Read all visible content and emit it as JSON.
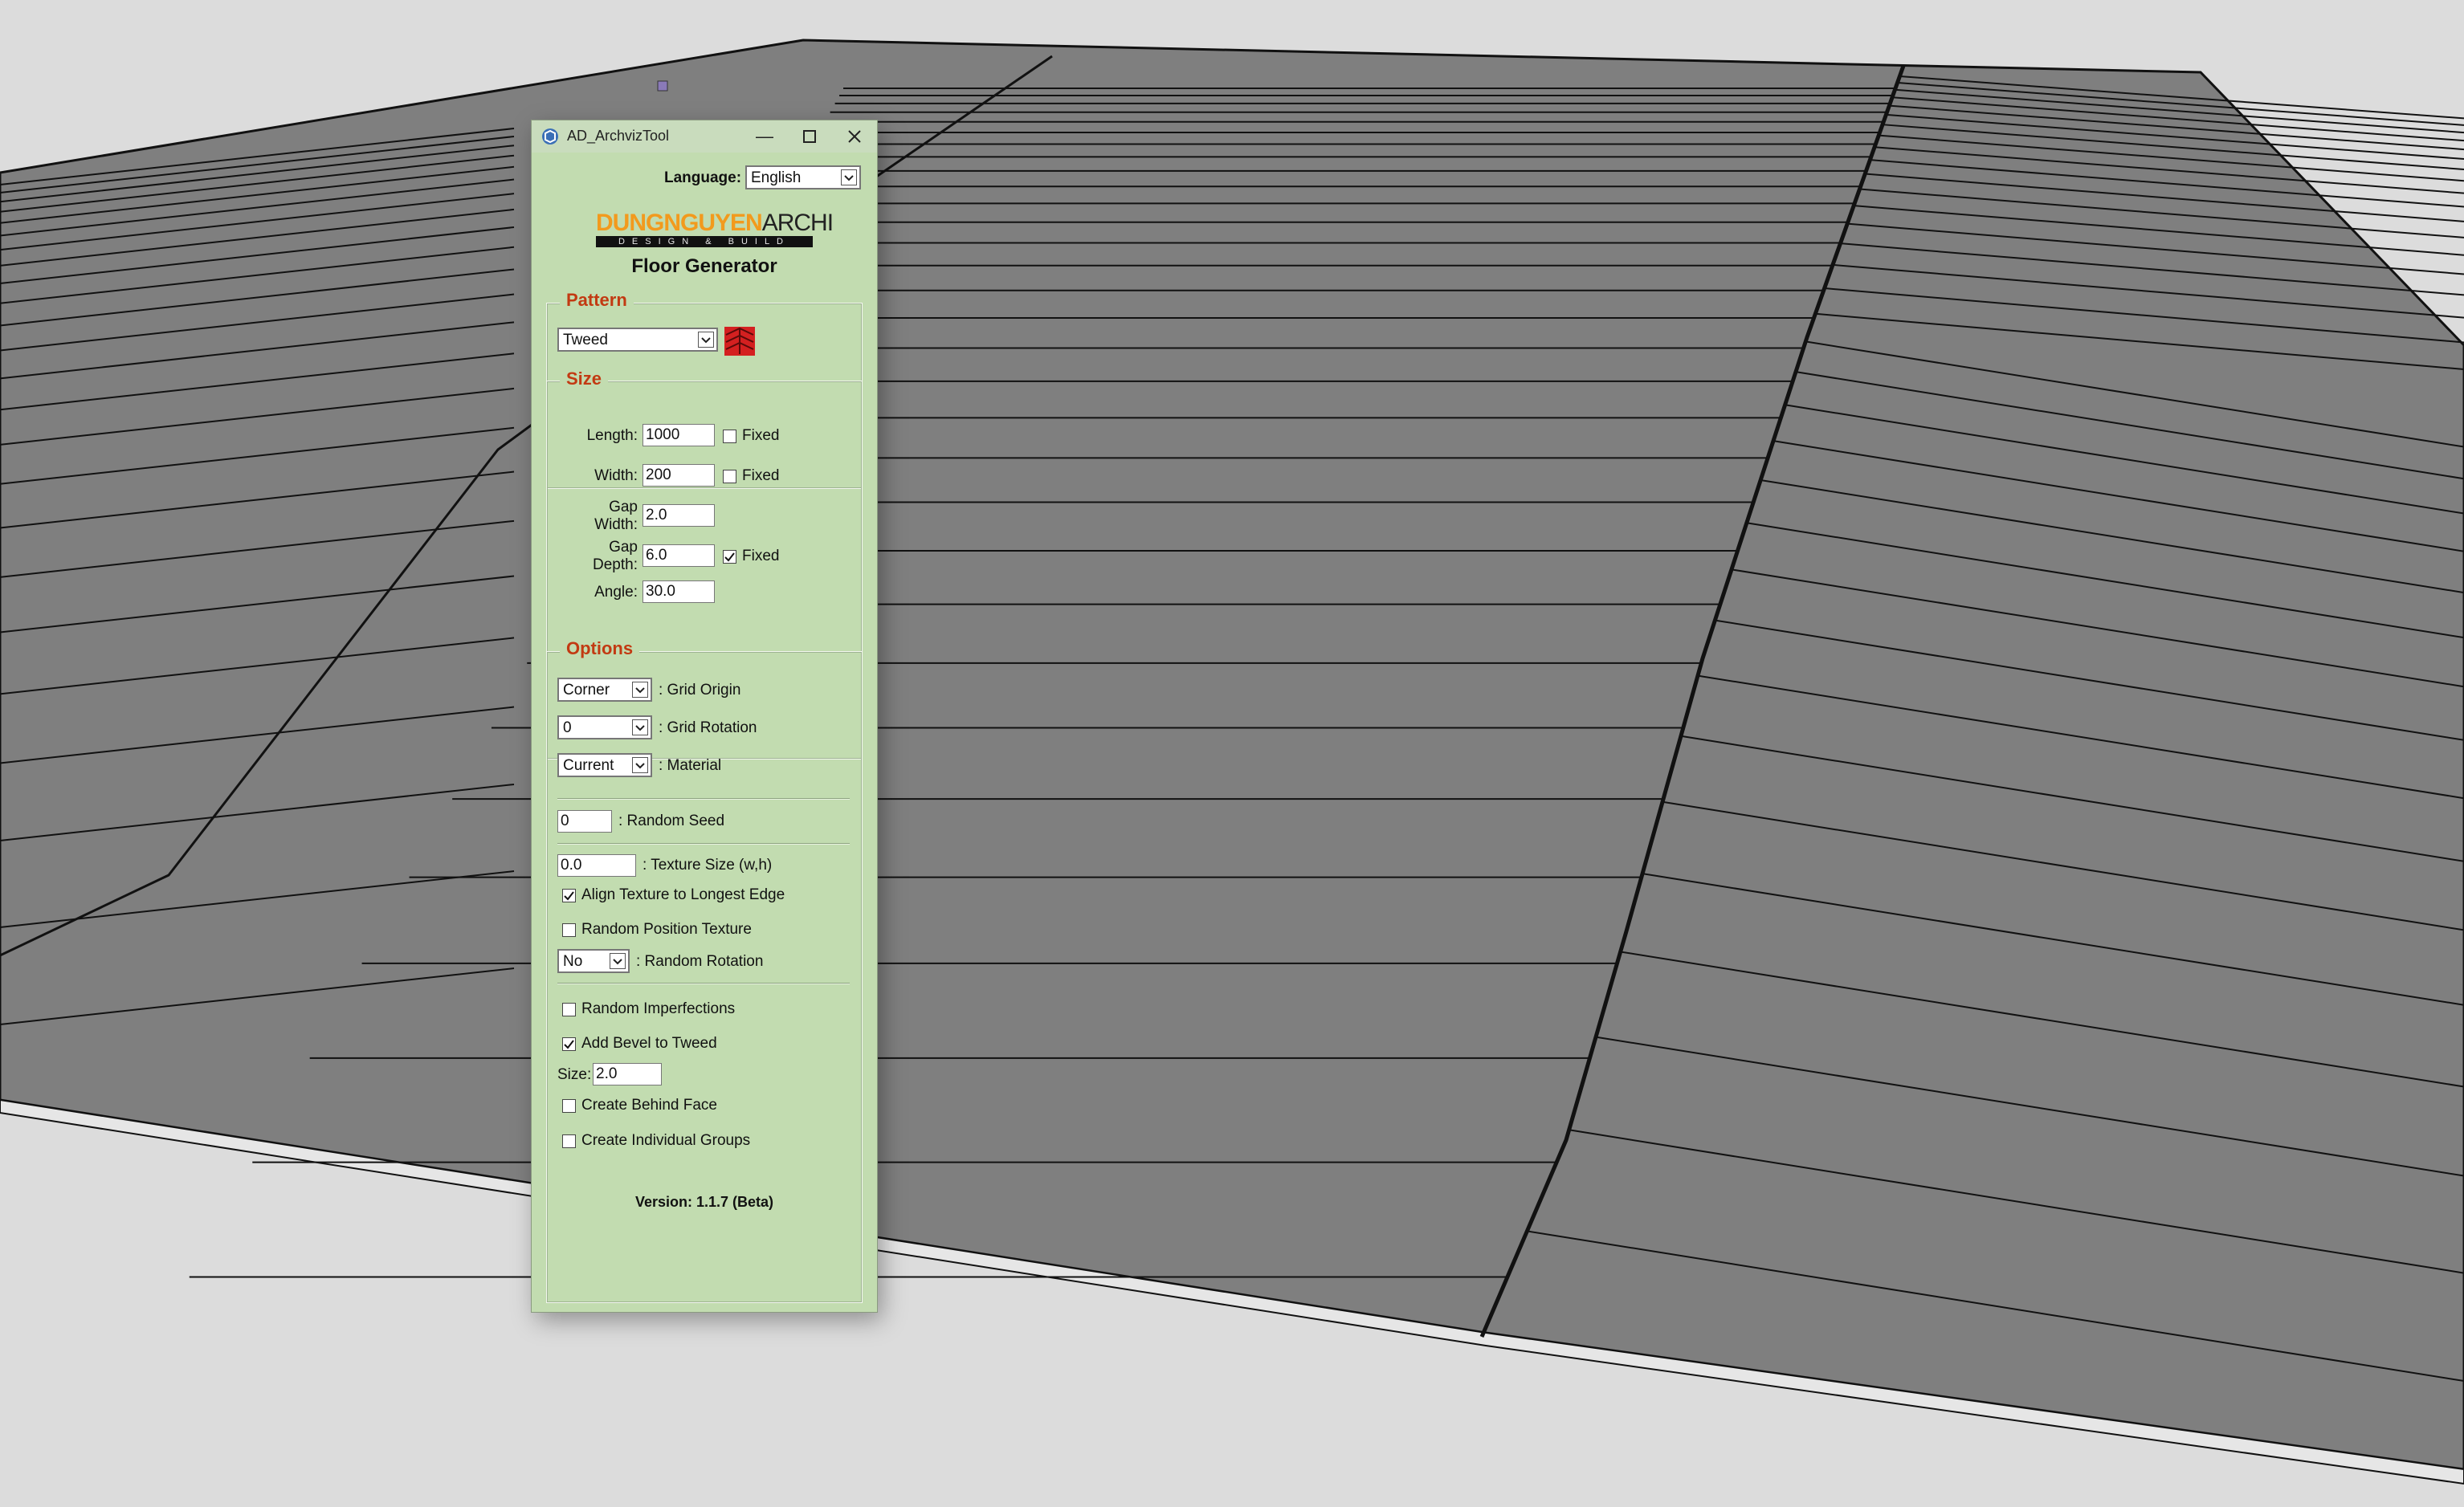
{
  "window": {
    "title": "AD_ArchvizTool"
  },
  "language": {
    "label": "Language:",
    "value": "English"
  },
  "logo": {
    "brand_orange": "DUNGNGUYEN",
    "brand_dark": "ARCHI",
    "tagline": "DESIGN & BUILD"
  },
  "tool_title": "Floor Generator",
  "pattern": {
    "legend": "Pattern",
    "value": "Tweed",
    "icon": "herringbone-pattern-icon"
  },
  "size": {
    "legend": "Size",
    "length": {
      "label": "Length:",
      "value": "1000",
      "fixed_label": "Fixed",
      "fixed": false
    },
    "width": {
      "label": "Width:",
      "value": "200",
      "fixed_label": "Fixed",
      "fixed": false
    },
    "gap_width": {
      "label_1": "Gap",
      "label_2": "Width:",
      "value": "2.0"
    },
    "gap_depth": {
      "label_1": "Gap",
      "label_2": "Depth:",
      "value": "6.0",
      "fixed_label": "Fixed",
      "fixed": true
    },
    "angle": {
      "label": "Angle:",
      "value": "30.0"
    }
  },
  "options": {
    "legend": "Options",
    "grid_origin": {
      "value": "Corner",
      "label": ": Grid Origin"
    },
    "grid_rotation": {
      "value": "0",
      "label": ": Grid Rotation"
    },
    "material": {
      "value": "Current",
      "label": ": Material"
    },
    "random_seed": {
      "value": "0",
      "label": ": Random Seed"
    },
    "texture_size": {
      "value": "0.0",
      "label": ": Texture Size (w,h)"
    },
    "align_texture": {
      "label": "Align Texture to Longest Edge",
      "checked": true
    },
    "random_position_texture": {
      "label": "Random Position Texture",
      "checked": false
    },
    "random_rotation": {
      "value": "No",
      "label": ": Random Rotation"
    },
    "random_imperfections": {
      "label": "Random Imperfections",
      "checked": false
    },
    "add_bevel": {
      "label": "Add Bevel to Tweed",
      "checked": true
    },
    "bevel_size": {
      "label": "Size:",
      "value": "2.0"
    },
    "create_behind_face": {
      "label": "Create Behind Face",
      "checked": false
    },
    "create_individual_groups": {
      "label": "Create Individual Groups",
      "checked": false
    }
  },
  "version": "Version: 1.1.7 (Beta)",
  "colors": {
    "panel": "#c2dcb0",
    "legend": "#c23a12",
    "logo_orange": "#f29a1d",
    "floor": "#7f7f7f",
    "background": "#dcdcdc"
  }
}
